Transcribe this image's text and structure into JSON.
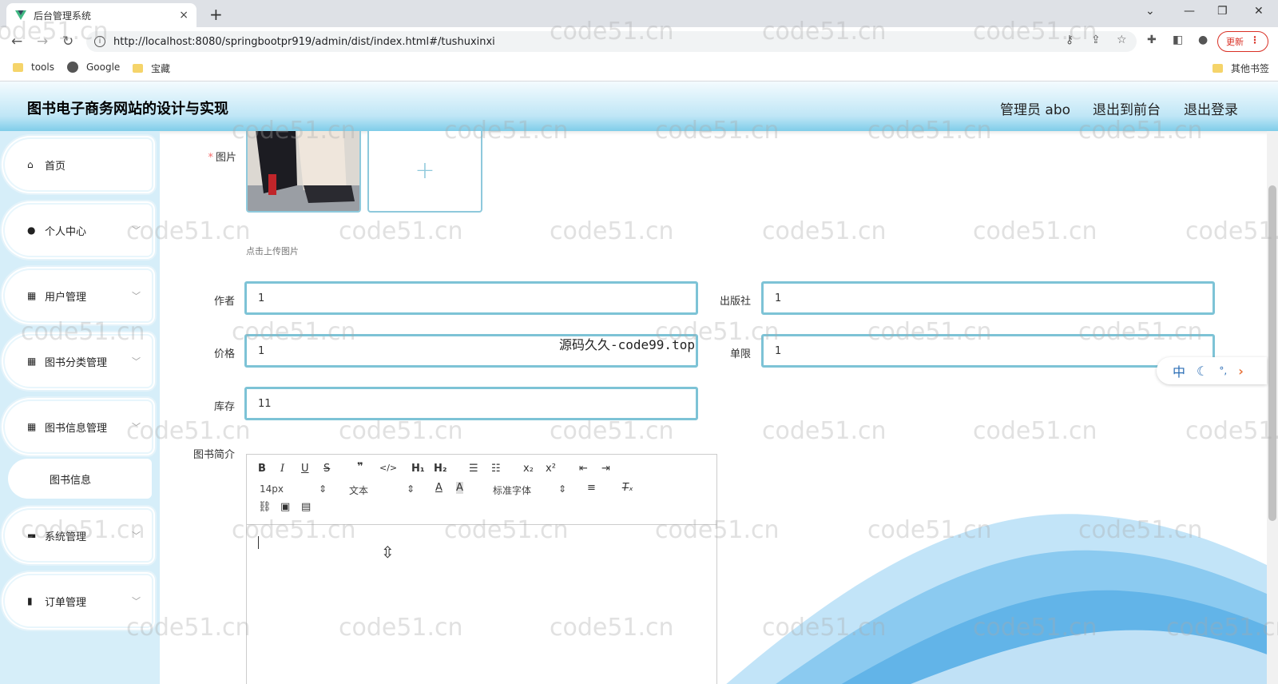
{
  "browser": {
    "tab_title": "后台管理系统",
    "tab_close": "×",
    "new_tab": "+",
    "url": "http://localhost:8080/springbootpr919/admin/dist/index.html#/tushuxinxi",
    "update_label": "更新",
    "bookmarks": [
      "tools",
      "Google",
      "宝藏"
    ],
    "other_bookmarks": "其他书签"
  },
  "header": {
    "title": "图书电子商务网站的设计与实现",
    "user": "管理员 abo",
    "to_front": "退出到前台",
    "logout": "退出登录"
  },
  "sidebar": {
    "items": [
      {
        "label": "首页",
        "icon": "home-icon"
      },
      {
        "label": "个人中心",
        "icon": "user-icon"
      },
      {
        "label": "用户管理",
        "icon": "grid-icon"
      },
      {
        "label": "图书分类管理",
        "icon": "grid-icon"
      },
      {
        "label": "图书信息管理",
        "icon": "grid-icon"
      },
      {
        "label": "图书信息",
        "icon": ""
      },
      {
        "label": "系统管理",
        "icon": "briefcase-icon"
      },
      {
        "label": "订单管理",
        "icon": "bar-chart-icon"
      }
    ]
  },
  "form": {
    "image_label": "图片",
    "upload_hint": "点击上传图片",
    "author_label": "作者",
    "author_value": "1",
    "publisher_label": "出版社",
    "publisher_value": "1",
    "price_label": "价格",
    "price_value": "1",
    "limit_label": "单限",
    "limit_value": "1",
    "stock_label": "库存",
    "stock_value": "11",
    "intro_label": "图书简介"
  },
  "editor": {
    "font_size": "14px",
    "block_type": "文本",
    "font_family": "标准字体"
  },
  "ime": {
    "lang": "中",
    "punct": "°,"
  },
  "watermark": {
    "text": "code51.cn",
    "center_text": "源码久久-code99.top"
  }
}
